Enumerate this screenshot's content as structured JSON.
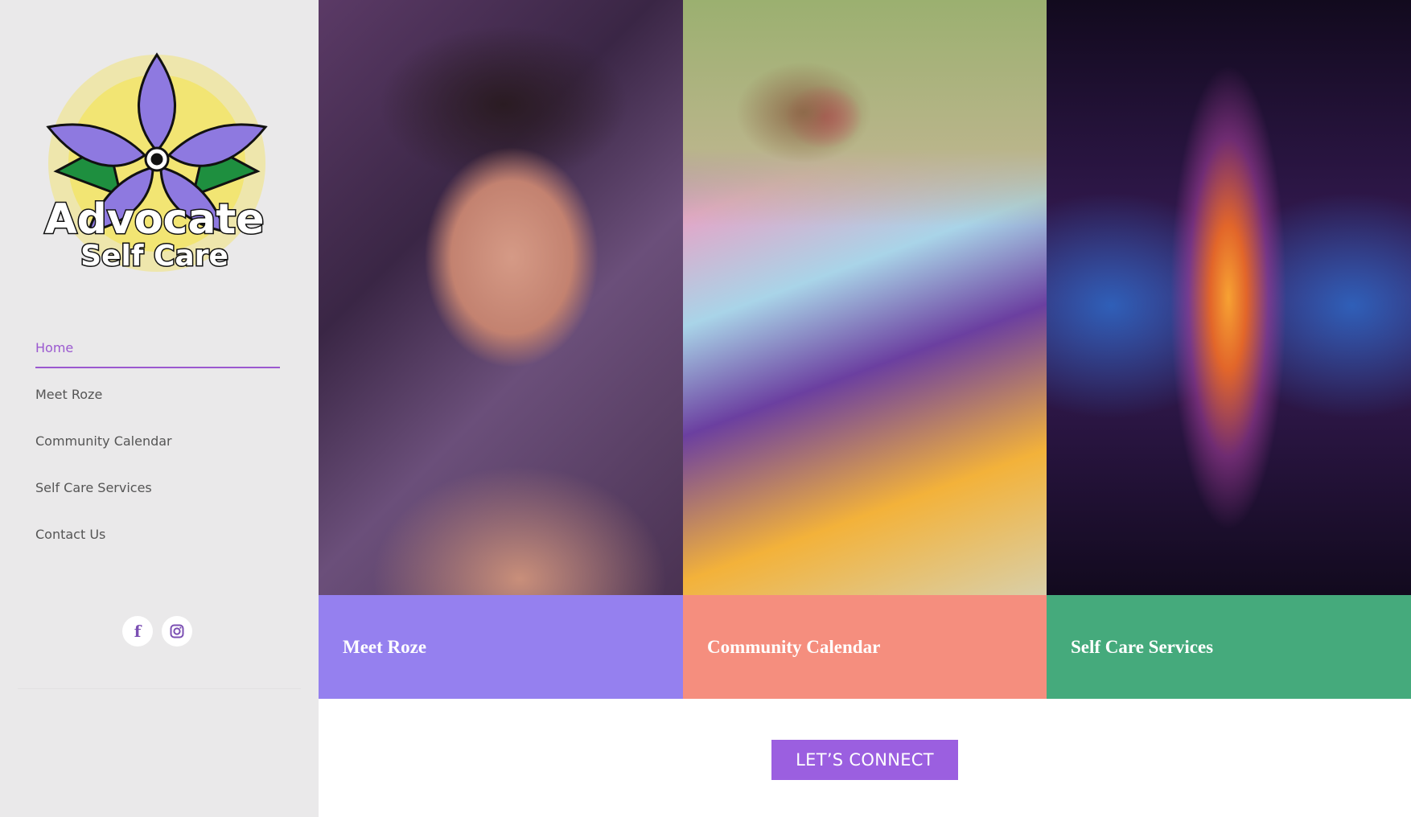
{
  "brand": {
    "logo_line1": "Advocate",
    "logo_line2": "Self Care",
    "colors": {
      "petal": "#8e79e0",
      "petal_dark": "#6a55c2",
      "sunburst": "#f6e33a",
      "leaf": "#1e8f3f"
    }
  },
  "sidebar": {
    "nav": [
      {
        "label": "Home",
        "active": true
      },
      {
        "label": "Meet Roze",
        "active": false
      },
      {
        "label": "Community Calendar",
        "active": false
      },
      {
        "label": "Self Care Services",
        "active": false
      },
      {
        "label": "Contact Us",
        "active": false
      }
    ],
    "socials": [
      {
        "icon": "facebook-icon",
        "glyph": "f"
      },
      {
        "icon": "instagram-icon",
        "glyph": ""
      }
    ],
    "accent_color": "#9b59d0"
  },
  "tiles": [
    {
      "label": "Meet Roze",
      "band_color": "#9580ef"
    },
    {
      "label": "Community Calendar",
      "band_color": "#f58e7e"
    },
    {
      "label": "Self Care Services",
      "band_color": "#45aa7c"
    }
  ],
  "cta": {
    "label": "LET’S CONNECT",
    "color": "#9b5fe0"
  }
}
